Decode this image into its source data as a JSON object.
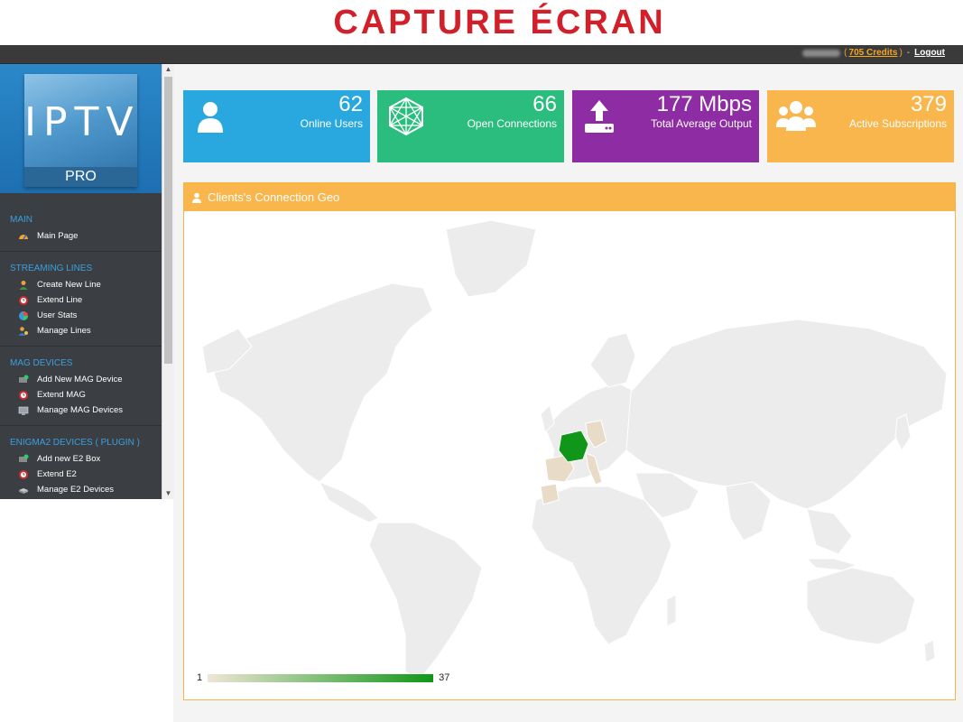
{
  "banner": {
    "title": "CAPTURE ÉCRAN"
  },
  "topbar": {
    "credits": "705 Credits",
    "logout": "Logout"
  },
  "logo": {
    "main": "IPTV",
    "sub": "PRO"
  },
  "nav": {
    "sections": [
      {
        "header": "MAIN",
        "items": [
          "Main Page"
        ]
      },
      {
        "header": "STREAMING LINES",
        "items": [
          "Create New Line",
          "Extend Line",
          "User Stats",
          "Manage Lines"
        ]
      },
      {
        "header": "MAG DEVICES",
        "items": [
          "Add New MAG Device",
          "Extend MAG",
          "Manage MAG Devices"
        ]
      },
      {
        "header": "ENIGMA2 DEVICES ( PLUGIN )",
        "items": [
          "Add new E2 Box",
          "Extend E2",
          "Manage E2 Devices"
        ]
      }
    ]
  },
  "stats": [
    {
      "value": "62",
      "label": "Online Users",
      "color": "#29a8e0"
    },
    {
      "value": "66",
      "label": "Open Connections",
      "color": "#2bbd7e"
    },
    {
      "value": "177 Mbps",
      "label": "Total Average Output",
      "color": "#8e2da3"
    },
    {
      "value": "379",
      "label": "Active Subscriptions",
      "color": "#f8b64c"
    }
  ],
  "map": {
    "title": "Clients's Connection Geo",
    "legend_min": "1",
    "legend_max": "37"
  },
  "colors": {
    "map_land": "#ececec",
    "map_highlight_strong": "#109618",
    "map_highlight_light": "#e8dcc8"
  }
}
